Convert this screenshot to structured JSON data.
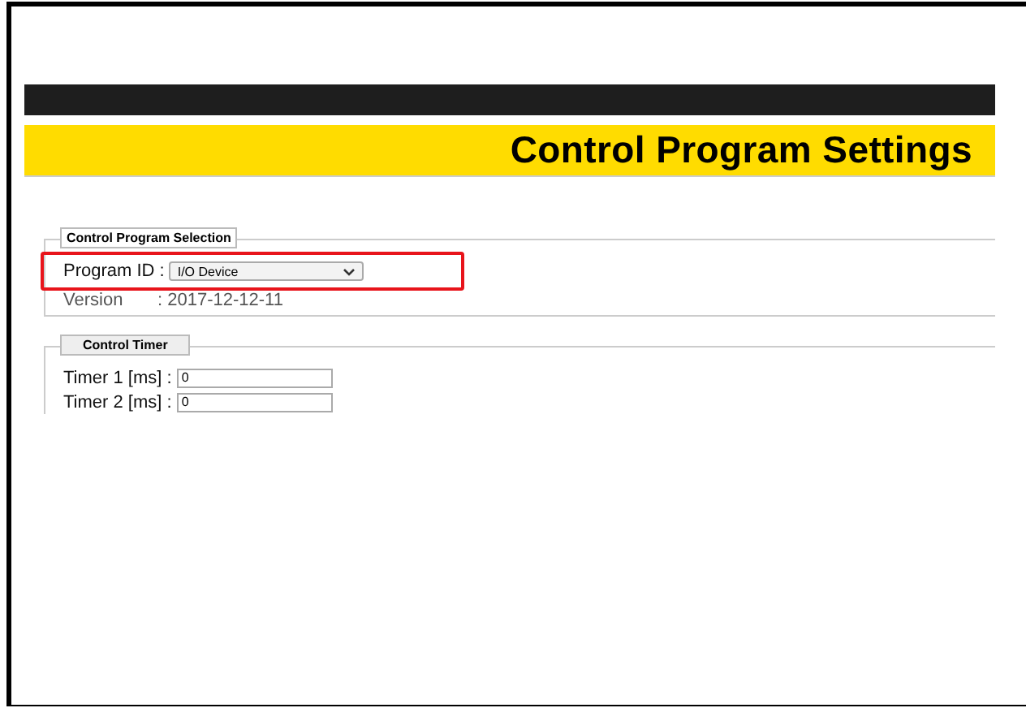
{
  "page_title": "Control Program Settings",
  "program_selection": {
    "legend": "Control Program Selection",
    "program_id_label": "Program ID :",
    "program_id_value": "I/O Device",
    "highlighted": true,
    "version_label": "Version",
    "version_value": ": 2017-12-12-11"
  },
  "control_timer": {
    "legend": "Control Timer",
    "fields": [
      {
        "label": "Timer 1 [ms] :",
        "value": "0"
      },
      {
        "label": "Timer 2 [ms] :",
        "value": "0"
      }
    ]
  }
}
